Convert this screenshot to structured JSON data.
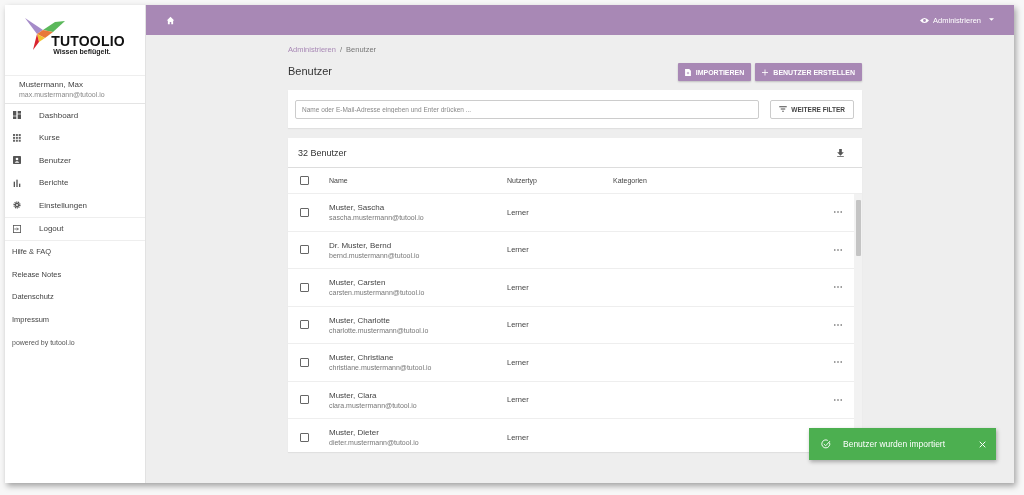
{
  "logo": {
    "name": "TUTOOLIO",
    "tagline": "Wissen beflügelt."
  },
  "user": {
    "name": "Mustermann, Max",
    "email": "max.mustermann@tutool.io"
  },
  "sidebar": {
    "items": [
      {
        "label": "Dashboard"
      },
      {
        "label": "Kurse"
      },
      {
        "label": "Benutzer"
      },
      {
        "label": "Berichte"
      },
      {
        "label": "Einstellungen"
      }
    ],
    "logout": "Logout",
    "links": [
      "Hilfe & FAQ",
      "Release Notes",
      "Datenschutz",
      "Impressum"
    ],
    "powered": "powered by tutool.io"
  },
  "topbar": {
    "menu": "Administrieren"
  },
  "breadcrumb": {
    "parent": "Administrieren",
    "separator": "/",
    "current": "Benutzer"
  },
  "title": "Benutzer",
  "actions": [
    {
      "label": "IMPORTIEREN"
    },
    {
      "label": "BENUTZER ERSTELLEN"
    }
  ],
  "search": {
    "placeholder": "Name oder E-Mail-Adresse eingeben und Enter drücken ..."
  },
  "filter_button": "WEITERE FILTER",
  "table": {
    "count": "32 Benutzer",
    "select_all": {
      "checked": false
    },
    "columns": [
      "Name",
      "Nutzertyp",
      "Kategorien"
    ],
    "rows": [
      {
        "name": "Muster, Sascha",
        "email": "sascha.mustermann@tutool.io",
        "type": "Lerner",
        "checked": false
      },
      {
        "name": "Dr. Muster, Bernd",
        "email": "bernd.mustermann@tutool.io",
        "type": "Lerner",
        "checked": false
      },
      {
        "name": "Muster, Carsten",
        "email": "carsten.mustermann@tutool.io",
        "type": "Lerner",
        "checked": false
      },
      {
        "name": "Muster, Charlotte",
        "email": "charlotte.mustermann@tutool.io",
        "type": "Lerner",
        "checked": false
      },
      {
        "name": "Muster, Christiane",
        "email": "christiane.mustermann@tutool.io",
        "type": "Lerner",
        "checked": false
      },
      {
        "name": "Muster, Clara",
        "email": "clara.mustermann@tutool.io",
        "type": "Lerner",
        "checked": false
      },
      {
        "name": "Muster, Dieter",
        "email": "dieter.mustermann@tutool.io",
        "type": "Lerner",
        "checked": false
      }
    ]
  },
  "toast": {
    "message": "Benutzer wurden importiert"
  }
}
